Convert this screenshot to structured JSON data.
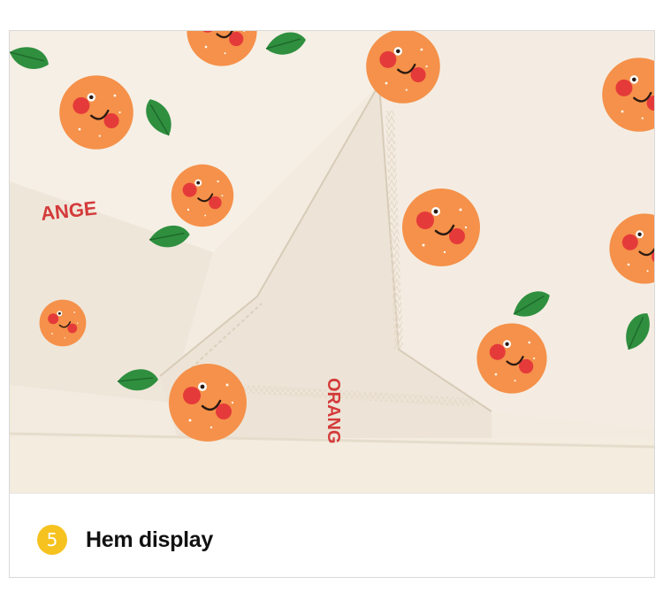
{
  "photo": {
    "subject_icon": "orange-print-fabric-hem",
    "colors": {
      "fabric": "#f3ebe0",
      "orange": "#f5914a",
      "leaf": "#2f8f3f",
      "cheek": "#e53a3a",
      "print_text": "#d43a3a"
    },
    "print_text_1": "ANGE",
    "print_text_2": "ORANG"
  },
  "caption": {
    "step_number": "5",
    "badge_color": "#f6c21f",
    "label": "Hem display"
  }
}
